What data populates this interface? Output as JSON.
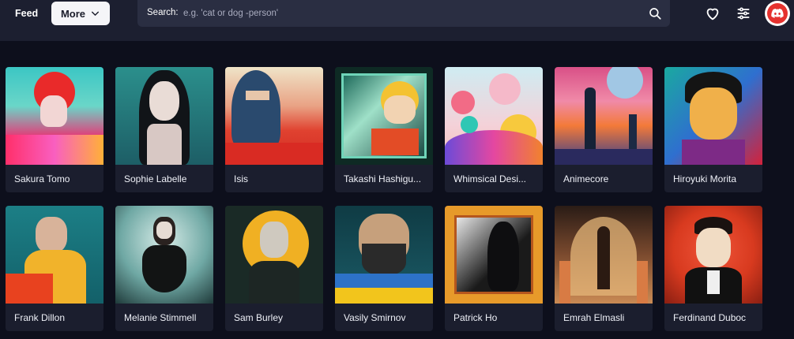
{
  "nav": {
    "feed_label": "Feed",
    "more_label": "More",
    "search_label": "Search:",
    "search_placeholder": "e.g. 'cat or dog -person'"
  },
  "icons": {
    "search": "search-icon",
    "heart": "heart-icon",
    "filters": "sliders-icon",
    "discord": "discord-icon"
  },
  "colors": {
    "background": "#0d0f1c",
    "topbar": "#1c1f30",
    "search_bg": "#2a2e42",
    "card_bg": "#1b1e2e",
    "discord_red": "#e5322f"
  },
  "cards": [
    {
      "title": "Sakura Tomo"
    },
    {
      "title": "Sophie Labelle"
    },
    {
      "title": "Isis"
    },
    {
      "title": "Takashi Hashigu..."
    },
    {
      "title": "Whimsical Desi..."
    },
    {
      "title": "Animecore"
    },
    {
      "title": "Hiroyuki Morita"
    },
    {
      "title": "Frank Dillon"
    },
    {
      "title": "Melanie Stimmell"
    },
    {
      "title": "Sam Burley"
    },
    {
      "title": "Vasily Smirnov"
    },
    {
      "title": "Patrick Ho"
    },
    {
      "title": "Emrah Elmasli"
    },
    {
      "title": "Ferdinand Duboc"
    }
  ]
}
